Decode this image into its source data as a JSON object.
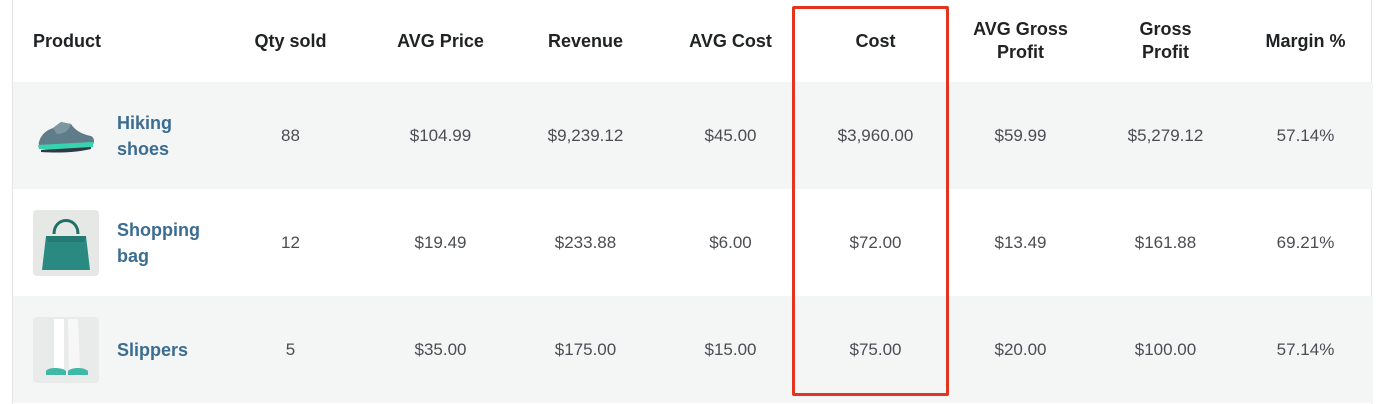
{
  "table": {
    "headers": {
      "product": "Product",
      "qty_sold": "Qty sold",
      "avg_price": "AVG Price",
      "revenue": "Revenue",
      "avg_cost": "AVG Cost",
      "cost": "Cost",
      "avg_gross_profit": "AVG Gross Profit",
      "gross_profit": "Gross Profit",
      "margin": "Margin %"
    },
    "rows": [
      {
        "product": "Hiking shoes",
        "qty_sold": "88",
        "avg_price": "$104.99",
        "revenue": "$9,239.12",
        "avg_cost": "$45.00",
        "cost": "$3,960.00",
        "avg_gross_profit": "$59.99",
        "gross_profit": "$5,279.12",
        "margin": "57.14%"
      },
      {
        "product": "Shopping bag",
        "qty_sold": "12",
        "avg_price": "$19.49",
        "revenue": "$233.88",
        "avg_cost": "$6.00",
        "cost": "$72.00",
        "avg_gross_profit": "$13.49",
        "gross_profit": "$161.88",
        "margin": "69.21%"
      },
      {
        "product": "Slippers",
        "qty_sold": "5",
        "avg_price": "$35.00",
        "revenue": "$175.00",
        "avg_cost": "$15.00",
        "cost": "$75.00",
        "avg_gross_profit": "$20.00",
        "gross_profit": "$100.00",
        "margin": "57.14%"
      }
    ]
  },
  "colors": {
    "highlight": "#e3341f",
    "link": "#3b6c91",
    "alt_row": "#f4f6f6"
  },
  "icons": [
    "shoe-thumbnail",
    "bag-thumbnail",
    "slippers-thumbnail"
  ]
}
